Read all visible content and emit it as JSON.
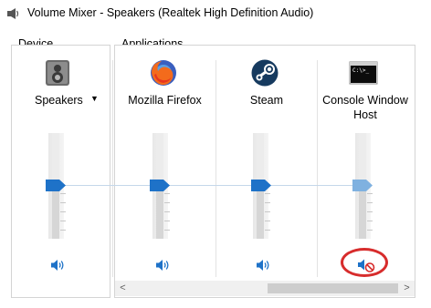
{
  "window": {
    "title": "Volume Mixer - Speakers (Realtek High Definition Audio)"
  },
  "device": {
    "group_label_accel": "D",
    "group_label_rest": "evice",
    "name": "Speakers",
    "icon": "speaker-device-icon",
    "dropdown_icon": "dropdown-arrow-icon",
    "volume_percent": 50,
    "muted": false
  },
  "applications": {
    "group_label": "Applications",
    "items": [
      {
        "name": "Mozilla Firefox",
        "icon": "firefox-icon",
        "volume_percent": 50,
        "muted": false
      },
      {
        "name": "Steam",
        "icon": "steam-icon",
        "volume_percent": 50,
        "muted": false
      },
      {
        "name": "Console Window Host",
        "name_line1": "Console Window",
        "name_line2": "Host",
        "icon": "console-window-icon",
        "volume_percent": 50,
        "muted": true
      }
    ]
  },
  "colors": {
    "accent_blue": "#1e72c8",
    "muted_thumb": "#7fb1e0",
    "highlight_circle": "#d72c2c"
  },
  "scrollbar": {
    "left_arrow": "<",
    "right_arrow": ">"
  }
}
